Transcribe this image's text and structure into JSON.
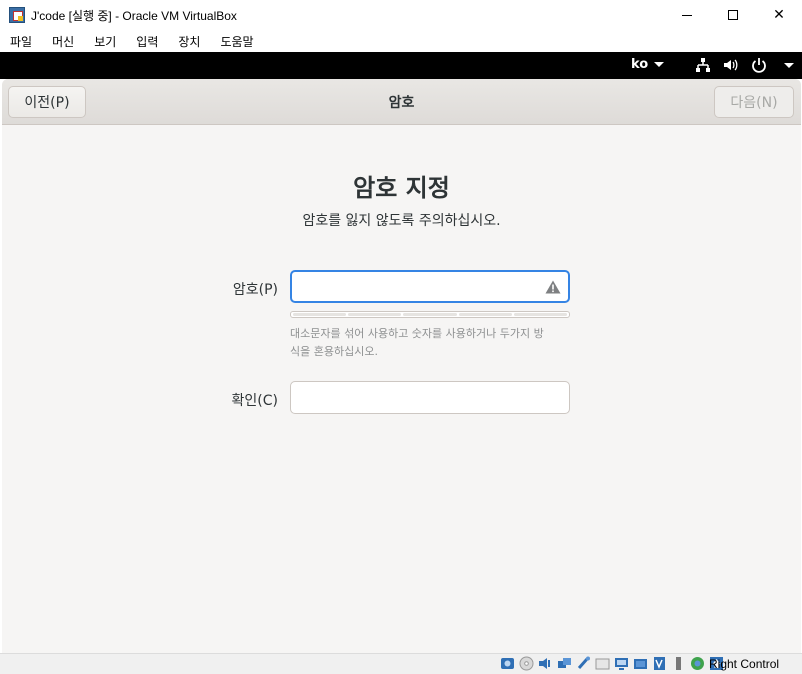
{
  "window": {
    "title": "J'code [실행 중] - Oracle VM VirtualBox",
    "controls": {
      "minimize": "minimize",
      "maximize": "maximize",
      "close": "✕"
    }
  },
  "menubar": {
    "items": [
      "파일",
      "머신",
      "보기",
      "입력",
      "장치",
      "도움말"
    ]
  },
  "guest_panel": {
    "language": "ko"
  },
  "headerbar": {
    "prev_label": "이전(P)",
    "title": "암호",
    "next_label": "다음(N)"
  },
  "main": {
    "heading": "암호 지정",
    "subheading": "암호를 잃지 않도록 주의하십시오.",
    "password_label": "암호(P)",
    "password_value": "",
    "hint_line1": "대소문자를 섞어 사용하고 숫자를 사용하거나 두가지 방",
    "hint_line2": "식을 혼용하십시오.",
    "confirm_label": "확인(C)",
    "confirm_value": "",
    "strength_level": 0
  },
  "statusbar": {
    "host_key": "Right Control"
  },
  "colors": {
    "focus_accent": "#3584e4",
    "guest_bg": "#f6f5f4",
    "guest_panel": "#000000"
  }
}
